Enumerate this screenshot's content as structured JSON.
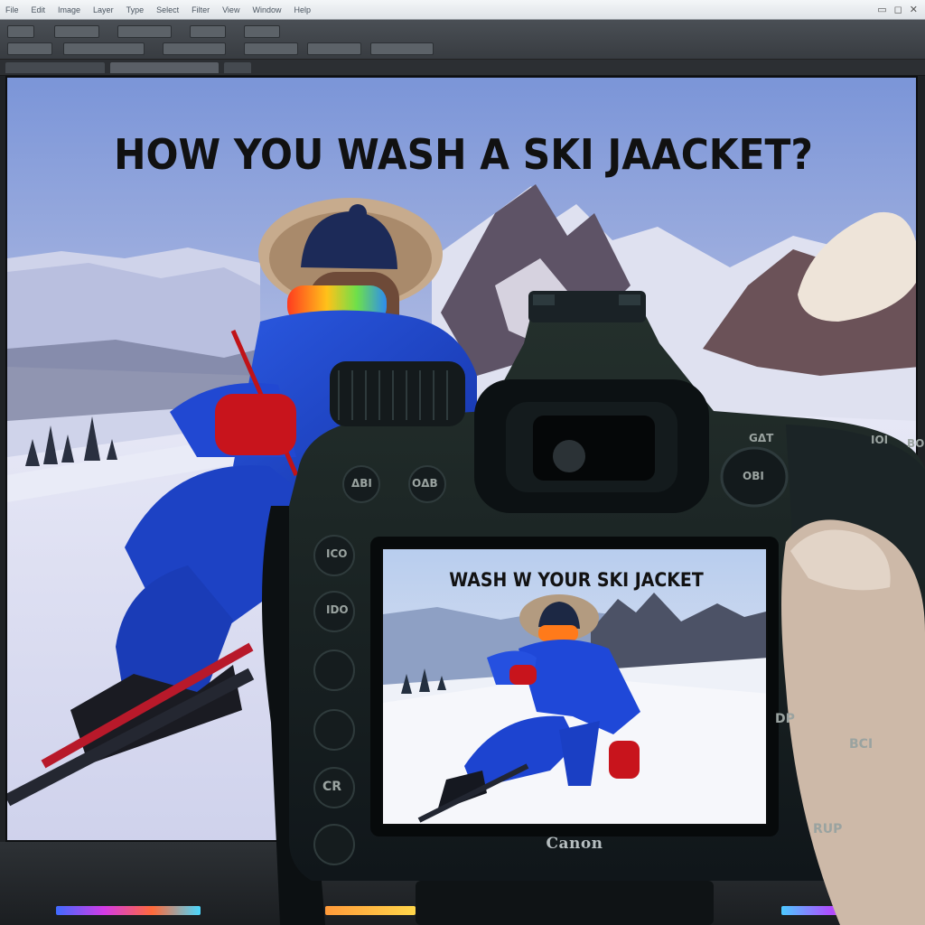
{
  "app": {
    "menu": [
      "File",
      "Edit",
      "Image",
      "Layer",
      "Type",
      "Select",
      "Filter",
      "View",
      "Window",
      "Help"
    ]
  },
  "monitor": {
    "headline": "HOW YOU WASH A SKI JAACKET?"
  },
  "camera": {
    "lcd_title": "WASH W YOUR SKI JACKET",
    "brand": "Canon",
    "buttons": {
      "top_left": "ΔBI",
      "top_mid": "OΔB",
      "top_right_a": "GΔT",
      "top_right_b": "IOI",
      "top_right_c": "BOI",
      "dial": "OBI",
      "left_1": "ICO",
      "left_2": "IDO",
      "left_5": "CR",
      "right_1": "DP",
      "right_2": "BCI",
      "right_3": "RUP"
    }
  },
  "colors": {
    "sky_top": "#7d97d9",
    "sky_bottom": "#f0c9a8",
    "jacket_blue": "#1c44c8",
    "glove_red": "#c8141c",
    "camera_body": "#1a2421"
  }
}
